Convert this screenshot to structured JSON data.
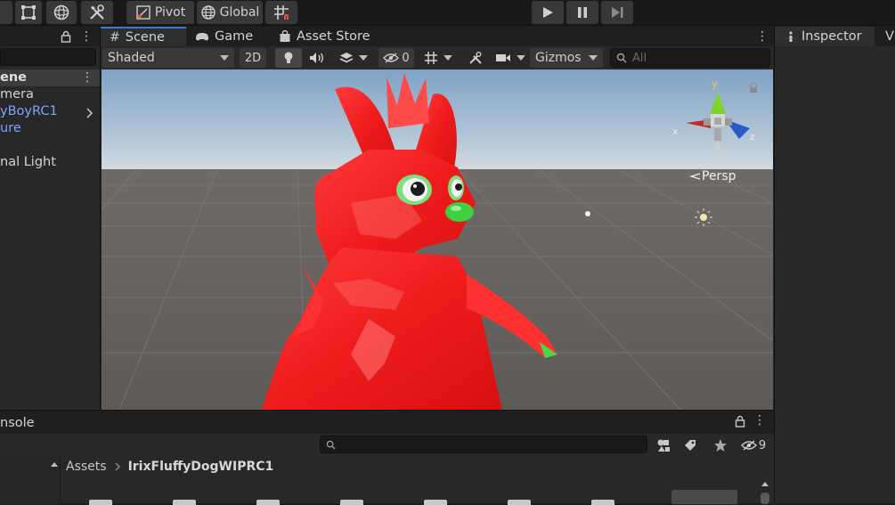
{
  "toolbar": {
    "pivot_label": "Pivot",
    "global_label": "Global"
  },
  "tabs": {
    "scene": "Scene",
    "game": "Game",
    "asset_store": "Asset Store",
    "inspector": "Inspector",
    "cut_tab": "V"
  },
  "scene_toolbar": {
    "shading_mode": "Shaded",
    "mode_2d": "2D",
    "hidden_count": "0",
    "gizmos_label": "Gizmos",
    "search_placeholder": "All"
  },
  "viewport": {
    "persp_label": "Persp",
    "axis_x": "x",
    "axis_y": "y",
    "axis_z": "z"
  },
  "hierarchy": {
    "scene_label": "ene",
    "items": [
      {
        "label": "mera",
        "color": "#d4d4d4"
      },
      {
        "label": "yBoyRC1",
        "color": "#7aa4ff"
      },
      {
        "label": "ure",
        "color": "#7aa4ff"
      },
      {
        "label": "nal Light",
        "color": "#d4d4d4"
      }
    ]
  },
  "bottom": {
    "console_tab": "nsole",
    "breadcrumb_root": "Assets",
    "breadcrumb_folder": "IrixFluffyDogWIPRC1",
    "hidden_count": "9"
  },
  "colors": {
    "accent_blue": "#7aa4ff",
    "panel_bg": "#282828",
    "toolbar_bg": "#191919"
  }
}
